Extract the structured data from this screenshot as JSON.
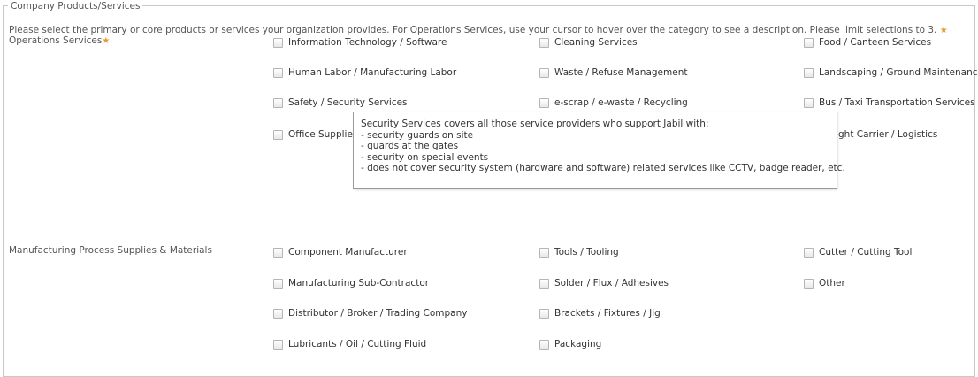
{
  "fieldset": {
    "legend": "Company Products/Services",
    "instructions": "Please select the primary or core products or services your organization provides. For Operations Services, use your cursor to hover over the category to see a description. Please limit selections to 3.",
    "required_marker": "★"
  },
  "operations": {
    "label": "Operations Services",
    "items": [
      "Information Technology / Software",
      "Cleaning Services",
      "Food / Canteen Services",
      "Human Labor / Manufacturing Labor",
      "Waste / Refuse Management",
      "Landscaping / Ground Maintenance",
      "Safety / Security Services",
      "e-scrap / e-waste / Recycling",
      "Bus / Taxi Transportation Services",
      "Office Supplies",
      "ght Carrier / Logistics"
    ]
  },
  "tooltip": {
    "lines": [
      "Security Services covers all those service providers who support Jabil with:",
      "- security guards on site",
      "- guards at the gates",
      "- security on special events",
      "- does not cover security system (hardware and software) related services like CCTV, badge reader, etc."
    ]
  },
  "manufacturing": {
    "label": "Manufacturing Process Supplies & Materials",
    "items": [
      "Component Manufacturer",
      "Tools / Tooling",
      "Cutter / Cutting Tool",
      "Manufacturing Sub-Contractor",
      "Solder / Flux / Adhesives",
      "Other",
      "Distributor / Broker / Trading Company",
      "Brackets / Fixtures / Jig",
      "Lubricants / Oil / Cutting Fluid",
      "Packaging"
    ]
  },
  "colors": {
    "star": "#e39b2e",
    "border": "#c8c8c8",
    "text": "#333333"
  }
}
